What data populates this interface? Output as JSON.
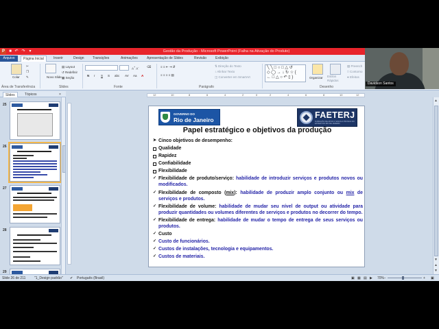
{
  "window": {
    "title": "Gestão da Produção - Microsoft PowerPoint (Falha na Ativação do Produto)"
  },
  "tabs": [
    "Arquivo",
    "Página Inicial",
    "Inserir",
    "Design",
    "Transições",
    "Animações",
    "Apresentação de Slides",
    "Revisão",
    "Exibição"
  ],
  "ribbon": {
    "clipboard": {
      "paste": "Colar",
      "label": "Área de Transferência"
    },
    "slides": {
      "new_slide": "Novo Slide",
      "layout": "Layout",
      "reset": "Redefinir",
      "section": "Seção",
      "label": "Slides"
    },
    "font": {
      "label": "Fonte"
    },
    "paragraph": {
      "text_direction": "Direção do Texto",
      "align_text": "Alinhar Texto",
      "smartart": "Converter em SmartArt",
      "label": "Parágrafo"
    },
    "drawing": {
      "arrange": "Organizar",
      "quick_styles": "Estilos Rápidos",
      "shape_fill": "Preench",
      "shape_outline": "Contorno",
      "shape_effects": "Efeitos",
      "label": "Desenho"
    }
  },
  "left_panel": {
    "tabs": [
      "Slides",
      "Tópicos"
    ],
    "thumbnails": [
      {
        "number": "25"
      },
      {
        "number": "26",
        "selected": true
      },
      {
        "number": "27"
      },
      {
        "number": "28"
      },
      {
        "number": "29"
      }
    ]
  },
  "slide": {
    "logo_left_small": "GOVERNO DO",
    "logo_left_big": "Rio de Janeiro",
    "logo_right": "FAETERJ",
    "logo_right_sub": "FUNDAÇÃO DE APOIO À ESCOLA TÉCNICA DO ESTADO DO RIO DE JANEIRO",
    "title": "Papel estratégico e objetivos da produção",
    "intro": "Cinco objetivos de desempenho:",
    "objectives": [
      "Qualidade",
      "Rapidez",
      "Confiabilidade",
      "Flexibilidade"
    ],
    "flex": [
      {
        "term": "Flexibilidade de produto/serviço:",
        "desc": "habilidade de introduzir serviços e produtos novos ou modificados."
      },
      {
        "term_a": "Flexibilidade de composto (",
        "term_u": "mix",
        "term_b": "):",
        "desc_a": "habilidade de produzir amplo conjunto ou ",
        "desc_u": "mix",
        "desc_b": " de serviços e produtos."
      },
      {
        "term": "Flexibilidade de volume:",
        "desc": "habilidade de mudar seu nível de output ou atividade para produzir quantidades ou volumes diferentes de serviços e produtos no decorrer do tempo."
      },
      {
        "term": "Flexibilidade de entrega:",
        "desc": "habilidade de mudar o tempo de entrega de seus serviços ou produtos."
      }
    ],
    "cost": "Custo",
    "costs": [
      "Custo de funcionários.",
      "Custos de instalações, tecnologia e equipamentos.",
      "Custos de materiais."
    ]
  },
  "status": {
    "slide_info": "Slide 26 de 211",
    "theme": "\"1_Design padrão\"",
    "language": "Português (Brasil)",
    "zoom": "70%"
  },
  "webcam": {
    "name": "Davidson Santos"
  },
  "colors": {
    "accent_red": "#e8242b",
    "text_blue": "#2525a8",
    "file_tab": "#2a5699"
  }
}
